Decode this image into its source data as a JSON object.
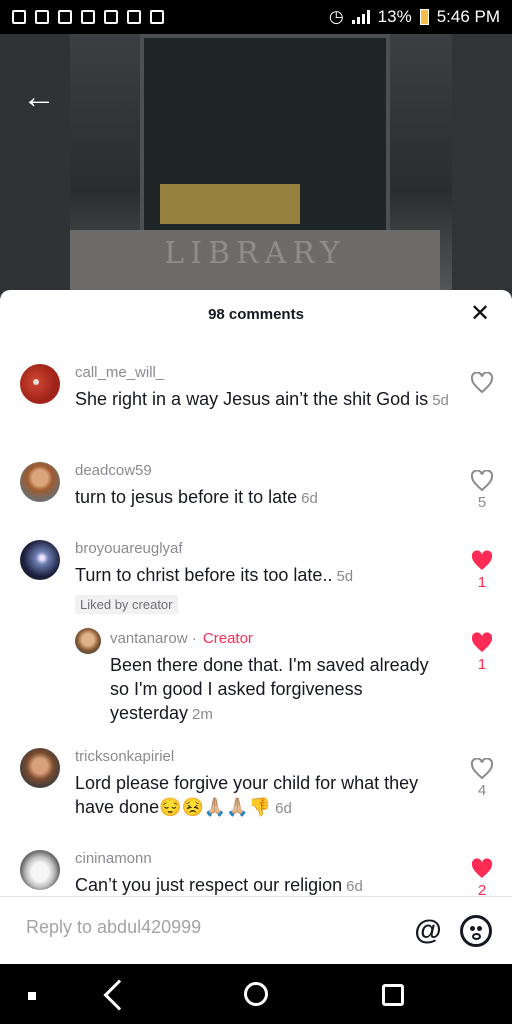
{
  "status_bar": {
    "battery": "13%",
    "time": "5:46 PM"
  },
  "video": {
    "sign_text": "LIBRARY"
  },
  "comments_header": {
    "count_label": "98 comments"
  },
  "comments": [
    {
      "username": "call_me_will_",
      "text": "She right in a way Jesus ain’t the shit God is",
      "age": "5d",
      "likes": "",
      "liked": false
    },
    {
      "username": "deadcow59",
      "text": "turn to jesus before it to late",
      "age": "6d",
      "likes": "5",
      "liked": false
    },
    {
      "username": "broyouareuglyaf",
      "text": "Turn to christ before its too late..",
      "age": "5d",
      "likes": "1",
      "liked": true,
      "badge": "Liked by creator"
    },
    {
      "username": "vantanarow",
      "creator_label": "Creator",
      "text": "Been there done that. I'm saved already so I'm good I asked forgiveness yesterday",
      "age": "2m",
      "likes": "1",
      "liked": true
    },
    {
      "username": "tricksonkapiriel",
      "text": "Lord please forgive your child for what they have done😔😣🙏🏼🙏🏼👎",
      "age": "6d",
      "likes": "4",
      "liked": false
    },
    {
      "username": "cininamonn",
      "text": "Can’t you just respect our religion",
      "age": "6d",
      "likes": "2",
      "liked": true
    }
  ],
  "reply": {
    "placeholder": "Reply to abdul420999"
  },
  "colors": {
    "accent": "#fe2c55",
    "muted": "#8a8b91",
    "text": "#161823"
  }
}
